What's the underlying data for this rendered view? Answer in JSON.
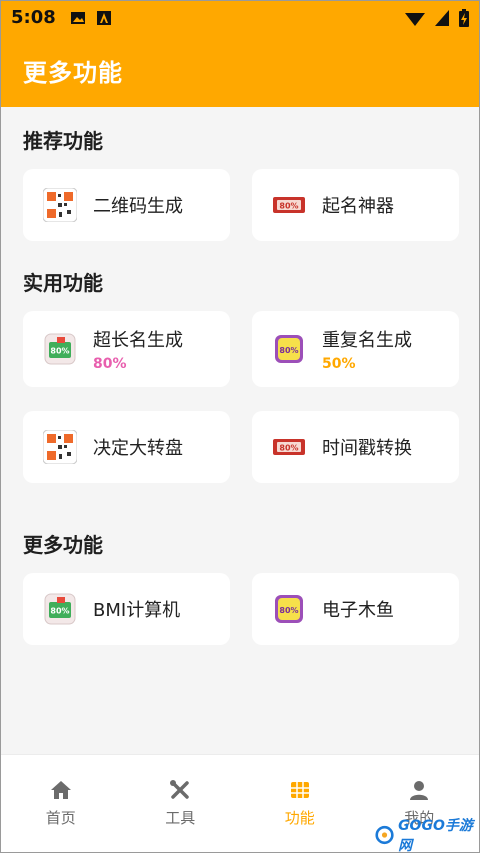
{
  "status_bar": {
    "time": "5:08"
  },
  "app_bar": {
    "title": "更多功能"
  },
  "sections": [
    {
      "title": "推荐功能"
    },
    {
      "title": "实用功能"
    },
    {
      "title": "更多功能"
    }
  ],
  "cards": {
    "qr": {
      "label": "二维码生成"
    },
    "name_gen": {
      "label": "起名神器"
    },
    "long_name": {
      "label": "超长名生成",
      "progress": "80%"
    },
    "dup_name": {
      "label": "重复名生成",
      "progress": "50%"
    },
    "wheel": {
      "label": "决定大转盘"
    },
    "timestamp": {
      "label": "时间戳转换"
    },
    "bmi": {
      "label": "BMI计算机"
    },
    "muyu": {
      "label": "电子木鱼"
    }
  },
  "icon_badge_text": "80%",
  "bottom_nav": [
    {
      "label": "首页",
      "icon": "home-icon"
    },
    {
      "label": "工具",
      "icon": "tools-icon"
    },
    {
      "label": "功能",
      "icon": "grid-icon",
      "active": true
    },
    {
      "label": "我的",
      "icon": "person-icon"
    }
  ],
  "watermark": {
    "text": "GOGO手游网"
  },
  "colors": {
    "accent": "#ffa800",
    "pink": "#e85fae",
    "orange": "#ffa800"
  }
}
